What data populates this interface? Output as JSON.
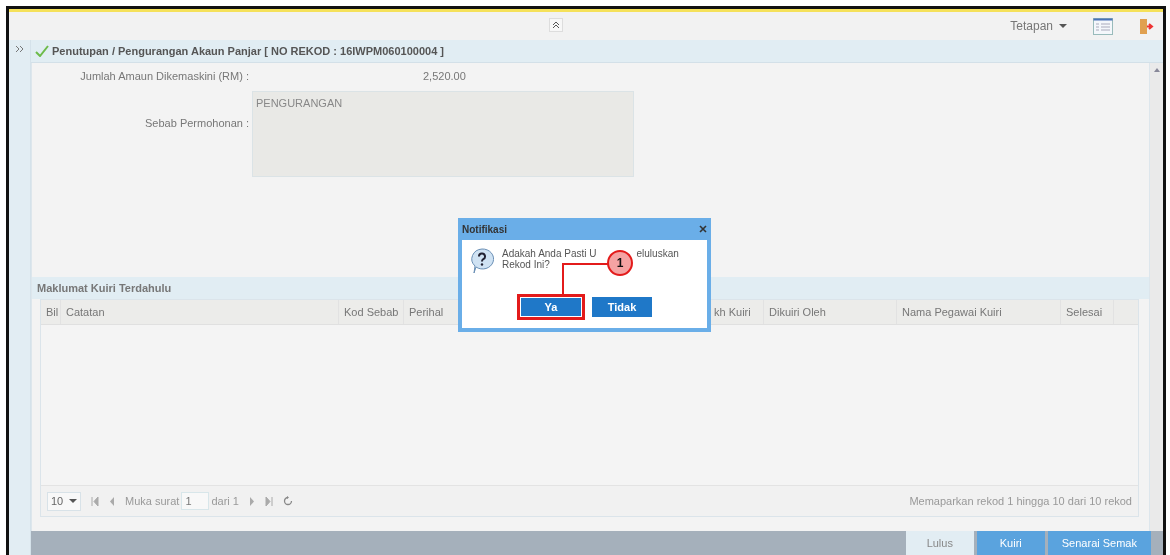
{
  "topbar": {
    "settings_label": "Tetapan"
  },
  "header": {
    "title": "Penutupan / Pengurangan Akaun Panjar [ NO REKOD : 16IWPM060100004 ]"
  },
  "form": [
    {
      "label": "Jumlah Amaun Dikemaskini (RM) :",
      "value": "2,520.00",
      "kind": "text"
    },
    {
      "label": "Sebab Permohonan :",
      "value": "PENGURANGAN",
      "kind": "textarea"
    }
  ],
  "query_section": {
    "title": "Maklumat Kuiri Terdahulu",
    "columns": [
      "Bil",
      "Catatan",
      "Kod Sebab",
      "Perihal",
      "kh Kuiri",
      "Dikuiri Oleh",
      "Nama Pegawai Kuiri",
      "Selesai"
    ],
    "pager": {
      "page_size": "10",
      "page_label": "Muka surat",
      "page": "1",
      "of_label": "dari 1",
      "summary": "Memaparkan rekod 1 hingga 10 dari 10 rekod"
    }
  },
  "actions": [
    {
      "label": "Lulus",
      "kind": "light"
    },
    {
      "label": "Kuiri",
      "kind": "primary"
    },
    {
      "label": "Senarai Semak",
      "kind": "primary"
    }
  ],
  "dialog": {
    "title": "Notifikasi",
    "message_before": "Adakah Anda Pasti U",
    "message_after": "eluluskan",
    "message_line2": "Rekod Ini?",
    "buttons": [
      {
        "label": "Ya",
        "selected": true
      },
      {
        "label": "Tidak",
        "selected": false
      }
    ]
  },
  "callout": {
    "number": "1"
  }
}
